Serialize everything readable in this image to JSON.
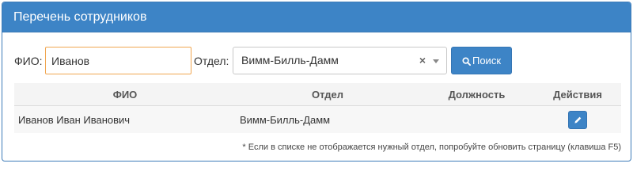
{
  "panel": {
    "title": "Перечень сотрудников"
  },
  "filters": {
    "fio_label": "ФИО:",
    "fio_value": "Иванов",
    "dept_label": "Отдел:",
    "dept_value": "Вимм-Билль-Дамм",
    "dept_clear": "×",
    "search_label": "Поиск",
    "search_icon": "search-icon"
  },
  "table": {
    "headers": [
      "ФИО",
      "Отдел",
      "Должность",
      "Действия"
    ],
    "rows": [
      {
        "fio": "Иванов Иван Иванович",
        "dept": "Вимм-Билль-Дамм",
        "position": "",
        "action_icon": "pencil-icon"
      }
    ]
  },
  "note": "* Если в списке не отображается нужный отдел, попробуйте обновить страницу (клавиша F5)",
  "colors": {
    "primary": "#3d84c6",
    "input_focus_border": "#f0a650"
  }
}
